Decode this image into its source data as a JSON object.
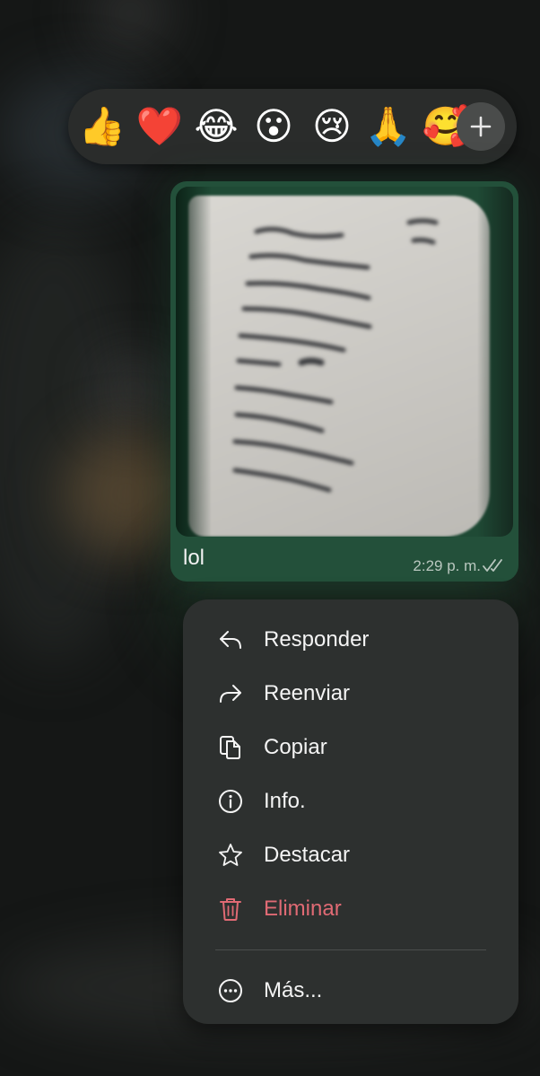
{
  "reactions": {
    "emojis": [
      "👍",
      "❤️",
      "😂",
      "😮",
      "😢",
      "🙏",
      "🥰"
    ],
    "more_icon": "plus-icon"
  },
  "message": {
    "caption": "lol",
    "time": "2:29 p. m.",
    "status_icon": "double-check-icon",
    "bubble_color": "#23503a"
  },
  "menu": {
    "items": [
      {
        "label": "Responder",
        "icon": "reply-icon"
      },
      {
        "label": "Reenviar",
        "icon": "forward-icon"
      },
      {
        "label": "Copiar",
        "icon": "copy-icon"
      },
      {
        "label": "Info.",
        "icon": "info-icon"
      },
      {
        "label": "Destacar",
        "icon": "star-icon"
      },
      {
        "label": "Eliminar",
        "icon": "trash-icon",
        "color": "#e06a74"
      }
    ],
    "more": {
      "label": "Más...",
      "icon": "ellipsis-icon"
    }
  }
}
